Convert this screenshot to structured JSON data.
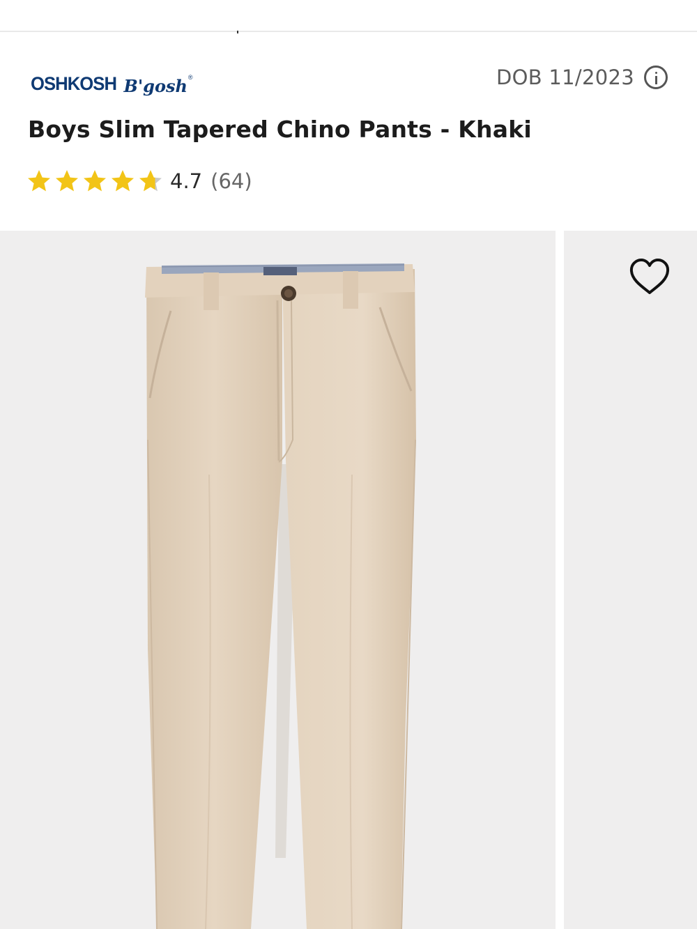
{
  "brand": {
    "logo_main": "OSHKOSH",
    "logo_script": "B'gosh",
    "logo_reg": "®",
    "color": "#0f3a73"
  },
  "dob": {
    "label": "DOB 11/2023",
    "icon": "info-icon"
  },
  "product": {
    "title": "Boys Slim Tapered Chino Pants - Khaki",
    "color_name": "Khaki",
    "swatch": "#e3d3bf"
  },
  "rating": {
    "value": "4.7",
    "count": "(64)",
    "score": 4.7,
    "max": 5,
    "star_color": "#f2c417",
    "empty_color": "#c9c9c9"
  },
  "gallery": {
    "favorite_icon": "heart-outline-icon",
    "background": "#efeeee"
  }
}
